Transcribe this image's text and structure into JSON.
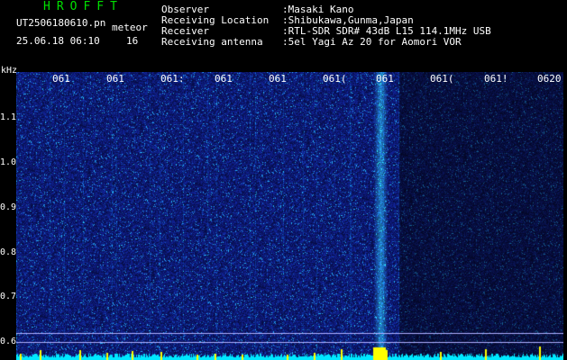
{
  "header": {
    "title": "HROFFT",
    "file_name": "UT2506180610.pn",
    "mode_label": "meteor",
    "datetime": "25.06.18 06:10",
    "count": "16"
  },
  "metadata": [
    {
      "label": "Observer",
      "value": ":Masaki Kano"
    },
    {
      "label": "Receiving Location",
      "value": ":Shibukawa,Gunma,Japan"
    },
    {
      "label": "Receiver",
      "value": ":RTL-SDR SDR# 43dB L15 114.1MHz USB"
    },
    {
      "label": "Receiving antenna",
      "value": ":5el Yagi Az 20 for Aomori VOR"
    }
  ],
  "plot": {
    "unit_label": "kHz",
    "y_ticks": [
      "1.1",
      "1.0",
      "0.9",
      "0.8",
      "0.7",
      "0.6"
    ],
    "x_ticks": [
      "061",
      "061",
      "061:",
      "061",
      "061",
      "061(",
      "061",
      "061(",
      "061!",
      "0620"
    ],
    "colors": {
      "background_noise": "#1a2a9a",
      "signal": "#00ffff",
      "strong_signal": "#ffff00",
      "text": "#ffffff",
      "title": "#00e000"
    }
  }
}
